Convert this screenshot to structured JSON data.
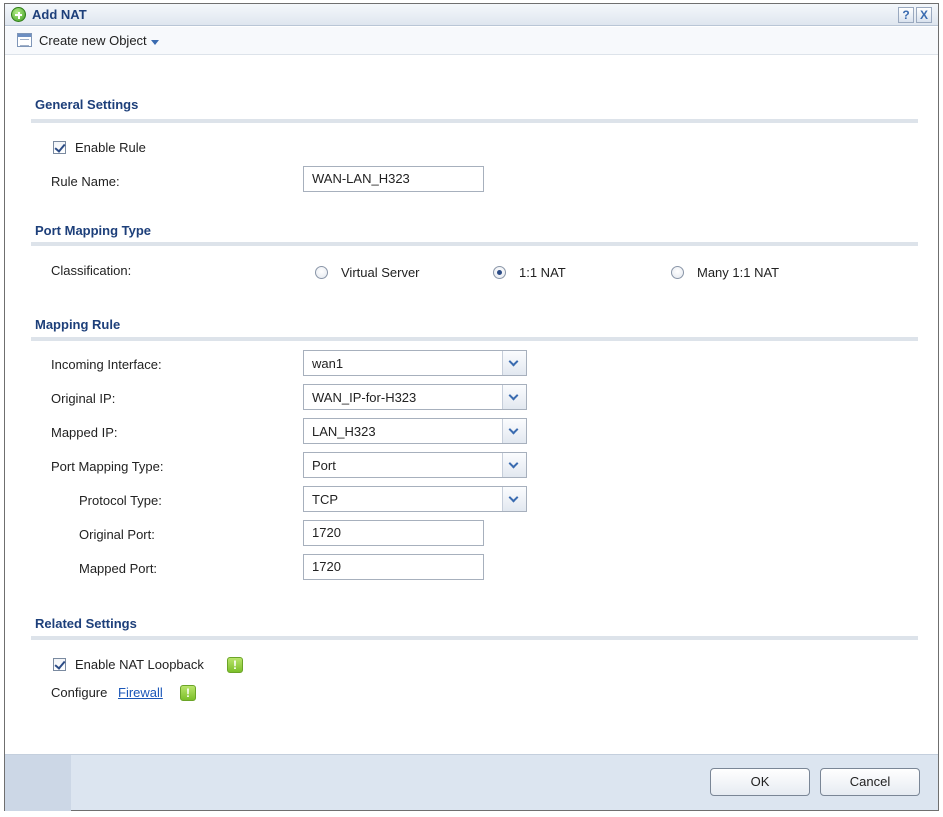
{
  "dialog": {
    "title": "Add NAT",
    "help_label": "?",
    "close_label": "X"
  },
  "toolbar": {
    "create_object_label": "Create new Object"
  },
  "general": {
    "section_title": "General Settings",
    "enable_rule_label": "Enable Rule",
    "enable_rule_checked": true,
    "rule_name_label": "Rule Name:",
    "rule_name_value": "WAN-LAN_H323"
  },
  "port_mapping": {
    "section_title": "Port Mapping Type",
    "classification_label": "Classification:",
    "options": [
      "Virtual Server",
      "1:1 NAT",
      "Many 1:1 NAT"
    ],
    "selected": "1:1 NAT"
  },
  "mapping_rule": {
    "section_title": "Mapping Rule",
    "incoming_interface": {
      "label": "Incoming Interface:",
      "value": "wan1"
    },
    "original_ip": {
      "label": "Original IP:",
      "value": "WAN_IP-for-H323"
    },
    "mapped_ip": {
      "label": "Mapped IP:",
      "value": "LAN_H323"
    },
    "port_mapping_type": {
      "label": "Port Mapping Type:",
      "value": "Port"
    },
    "protocol_type": {
      "label": "Protocol Type:",
      "value": "TCP"
    },
    "original_port": {
      "label": "Original Port:",
      "value": "1720"
    },
    "mapped_port": {
      "label": "Mapped Port:",
      "value": "1720"
    }
  },
  "related": {
    "section_title": "Related Settings",
    "nat_loopback_label": "Enable NAT Loopback",
    "nat_loopback_checked": true,
    "configure_label": "Configure",
    "firewall_link": "Firewall",
    "warn_glyph": "!"
  },
  "footer": {
    "ok_label": "OK",
    "cancel_label": "Cancel"
  },
  "colors": {
    "section_title": "#1d3f7a",
    "link": "#1a56b8",
    "warn": "#7cbf2a"
  }
}
